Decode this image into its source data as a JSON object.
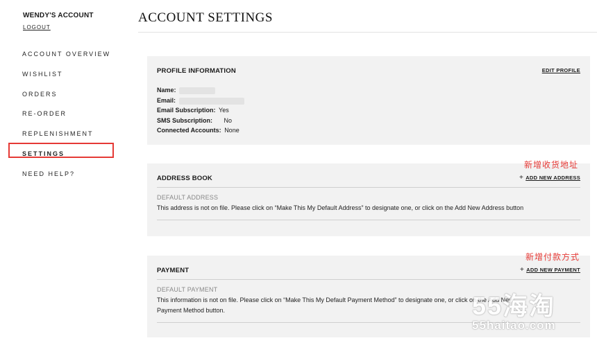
{
  "sidebar": {
    "account_name": "WENDY'S ACCOUNT",
    "logout": "LOGOUT",
    "items": [
      {
        "label": "ACCOUNT OVERVIEW"
      },
      {
        "label": "WISHLIST"
      },
      {
        "label": "ORDERS"
      },
      {
        "label": "RE-ORDER"
      },
      {
        "label": "REPLENISHMENT"
      },
      {
        "label": "SETTINGS"
      },
      {
        "label": "NEED HELP?"
      }
    ],
    "active_item": "SETTINGS"
  },
  "page_title": "ACCOUNT SETTINGS",
  "profile": {
    "title": "PROFILE INFORMATION",
    "edit_label": "EDIT PROFILE",
    "fields": {
      "name_label": "Name:",
      "email_label": "Email:",
      "email_sub_label": "Email Subscription:",
      "email_sub_value": "Yes",
      "sms_label": "SMS Subscription:",
      "sms_value": "No",
      "connected_label": "Connected Accounts:",
      "connected_value": "None"
    }
  },
  "address_book": {
    "title": "ADDRESS BOOK",
    "add_label": "ADD NEW ADDRESS",
    "default_label": "DEFAULT ADDRESS",
    "message": "This address is not on file. Please click on “Make This My Default Address” to designate one, or click on the Add New Address button",
    "annotation": "新增收货地址"
  },
  "payment": {
    "title": "PAYMENT",
    "add_label": "ADD NEW PAYMENT",
    "default_label": "DEFAULT PAYMENT",
    "message_line1": "This information is not on file. Please click on “Make This My Default Payment Method” to designate one, or click on the Add New",
    "message_line2": "Payment Method button.",
    "annotation": "新增付款方式"
  },
  "watermark": {
    "big": "55海淘",
    "small": "55haitao.com"
  },
  "colors": {
    "highlight": "#e53935",
    "panel_bg": "#f2f2f2"
  }
}
